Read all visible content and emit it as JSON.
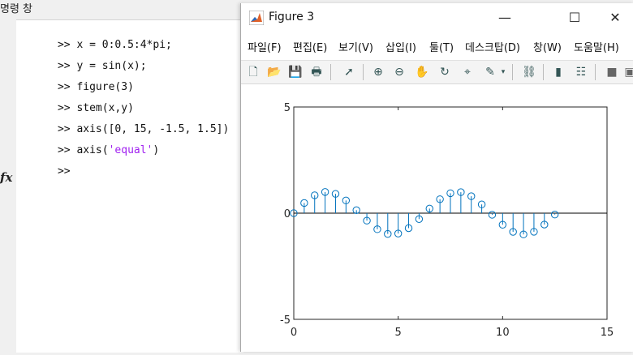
{
  "command_window": {
    "title": "명령 창",
    "prompt": ">>",
    "lines": [
      {
        "code": "x = 0:0.5:4*pi;"
      },
      {
        "code": "y = sin(x);"
      },
      {
        "code": "figure(3)"
      },
      {
        "code": "stem(x,y)"
      },
      {
        "code": "axis([0, 15, -1.5, 1.5])"
      },
      {
        "code_prefix": "axis(",
        "code_string": "'equal'",
        "code_suffix": ")"
      }
    ],
    "fx_label": "fx"
  },
  "figure": {
    "title": "Figure 3",
    "window_buttons": {
      "minimize": "—",
      "maximize": "☐",
      "close": "✕"
    },
    "menu": [
      "파일(F)",
      "편집(E)",
      "보기(V)",
      "삽입(I)",
      "툴(T)",
      "데스크탑(D)",
      "창(W)",
      "도움말(H)"
    ],
    "toolbar": [
      "new-figure",
      "open",
      "save",
      "print",
      "pointer",
      "zoom-in",
      "zoom-out",
      "pan",
      "rotate-3d",
      "data-cursor",
      "brush",
      "link",
      "colorbar",
      "legend",
      "hide-plot-tools",
      "show-plot-tools"
    ]
  },
  "chart_data": {
    "type": "stem",
    "x": [
      0,
      0.5,
      1,
      1.5,
      2,
      2.5,
      3,
      3.5,
      4,
      4.5,
      5,
      5.5,
      6,
      6.5,
      7,
      7.5,
      8,
      8.5,
      9,
      9.5,
      10,
      10.5,
      11,
      11.5,
      12,
      12.5
    ],
    "y": [
      0,
      0.479,
      0.841,
      0.997,
      0.909,
      0.598,
      0.141,
      -0.351,
      -0.757,
      -0.978,
      -0.959,
      -0.706,
      -0.279,
      0.215,
      0.657,
      0.938,
      0.989,
      0.798,
      0.412,
      -0.075,
      -0.544,
      -0.88,
      -1.0,
      -0.875,
      -0.537,
      -0.066
    ],
    "xlim": [
      0,
      15
    ],
    "ylim": [
      -5,
      5
    ],
    "xticks": [
      0,
      5,
      10,
      15
    ],
    "yticks": [
      -5,
      0,
      5
    ],
    "color": "#0072bd",
    "baseline_color": "#000000"
  }
}
